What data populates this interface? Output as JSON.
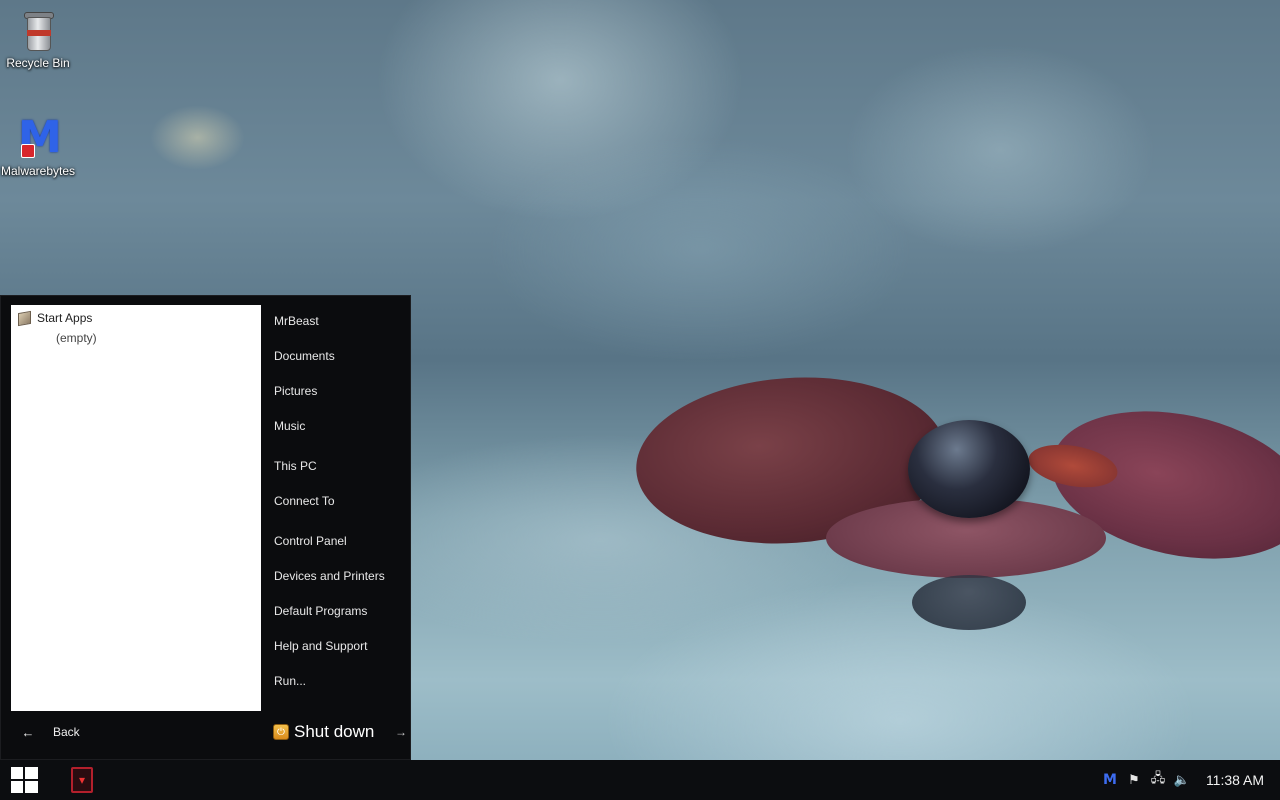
{
  "desktop": {
    "icons": [
      {
        "label": "Recycle Bin",
        "icon": "recycle-bin-icon"
      },
      {
        "label": "Malwarebytes",
        "icon": "malwarebytes-icon"
      }
    ]
  },
  "start_menu": {
    "apps_folder": "Start Apps",
    "apps_empty": "(empty)",
    "back_label": "Back",
    "places": [
      "MrBeast",
      "Documents",
      "Pictures",
      "Music",
      "This PC",
      "Connect To",
      "Control Panel",
      "Devices and Printers",
      "Default Programs",
      "Help and Support",
      "Run..."
    ],
    "shutdown_label": "Shut down"
  },
  "taskbar": {
    "clock": "11:38 AM",
    "tray_icons": [
      "malwarebytes-tray-icon",
      "flag-icon",
      "network-icon",
      "volume-icon"
    ],
    "glyphs": {
      "back_arrow": "←",
      "shutdown_arrow": "→",
      "flag": "⚑",
      "network": "🖧",
      "volume": "🔈",
      "mb": "M"
    }
  },
  "colors": {
    "start_menu_bg": "#0b0c0e",
    "taskbar_bg": "#0c0d10",
    "malwarebytes_blue": "#2f63e8"
  }
}
